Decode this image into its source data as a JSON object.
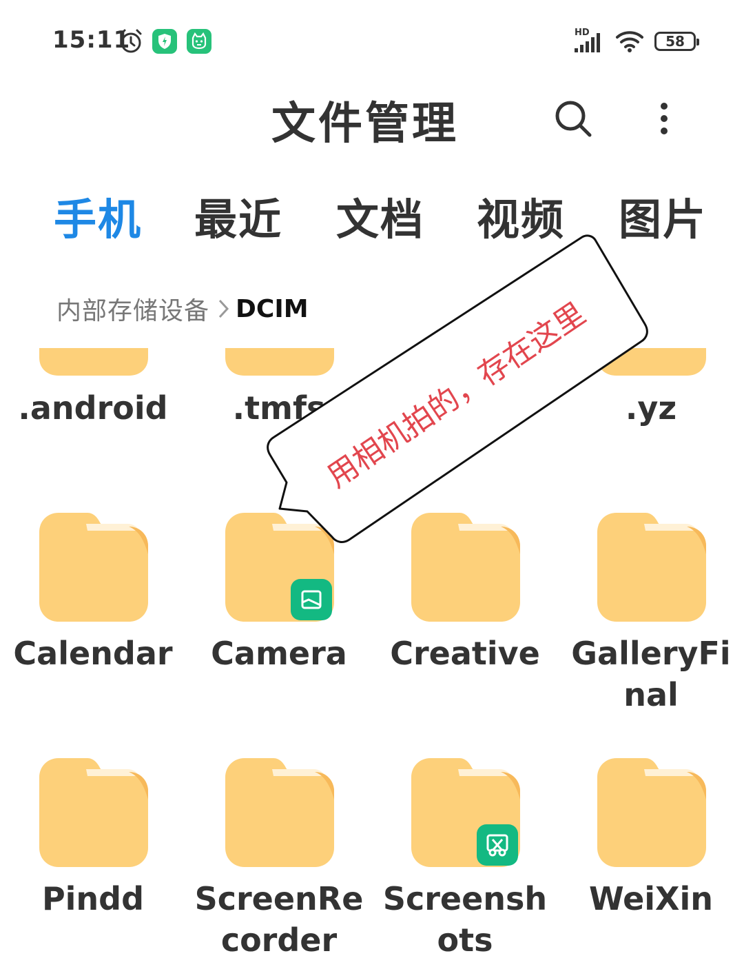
{
  "status_bar": {
    "time": "15:11",
    "signal_label": "HD",
    "battery_level": "58"
  },
  "header": {
    "title": "文件管理"
  },
  "tabs": [
    {
      "label": "手机",
      "active": true
    },
    {
      "label": "最近",
      "active": false
    },
    {
      "label": "文档",
      "active": false
    },
    {
      "label": "视频",
      "active": false
    },
    {
      "label": "图片",
      "active": false
    }
  ],
  "breadcrumb": {
    "root": "内部存储设备",
    "current": "DCIM"
  },
  "folders": [
    {
      "name": ".android"
    },
    {
      "name": ".tmfs"
    },
    {
      "name": ".yz"
    },
    {
      "name": "Calendar"
    },
    {
      "name": "Camera",
      "badge": "gallery-icon"
    },
    {
      "name": "Creative"
    },
    {
      "name": "GalleryFinal",
      "line1": "GalleryFi",
      "line2": "nal"
    },
    {
      "name": "Pindd"
    },
    {
      "name": "ScreenRecorder",
      "line1": "ScreenRe",
      "line2": "corder"
    },
    {
      "name": "Screenshots",
      "line1": "Screensh",
      "line2": "ots",
      "badge": "scissors-icon"
    },
    {
      "name": "WeiXin"
    }
  ],
  "annotation": {
    "text": "用相机拍的，存在这里"
  },
  "colors": {
    "accent": "#1e88e5",
    "folder": "#fdd07a",
    "badge": "#13b982",
    "annotation_text": "#e2464e"
  }
}
